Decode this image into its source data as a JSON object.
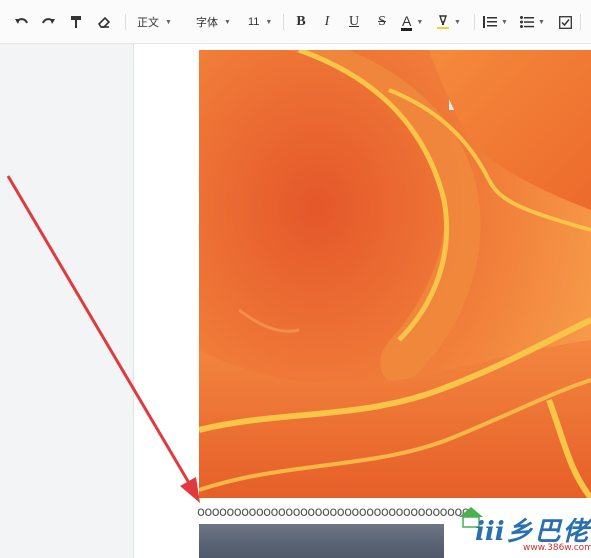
{
  "toolbar": {
    "undo_icon": "undo-icon",
    "redo_icon": "redo-icon",
    "format_painter_icon": "format-painter-icon",
    "eraser_icon": "eraser-icon",
    "style_label": "正文",
    "font_label": "字体",
    "size_label": "11",
    "bold_label": "B",
    "italic_label": "I",
    "underline_label": "U",
    "strike_label": "S",
    "font_color_label": "A",
    "highlight_icon": "highlight-icon",
    "ordered_list_icon": "ordered-list-icon",
    "bullet_list_icon": "bullet-list-icon",
    "checklist_icon": "checklist-icon"
  },
  "document": {
    "text_line": "ooooooooooooooooooooooooooooooooooooo"
  },
  "watermark": {
    "brand": "ⅲ乡巴佬",
    "url": "www.386w.com"
  },
  "colors": {
    "arrow": "#e03a3e",
    "photo_petal": "#f27a3a",
    "photo_edge": "#f5c040"
  }
}
